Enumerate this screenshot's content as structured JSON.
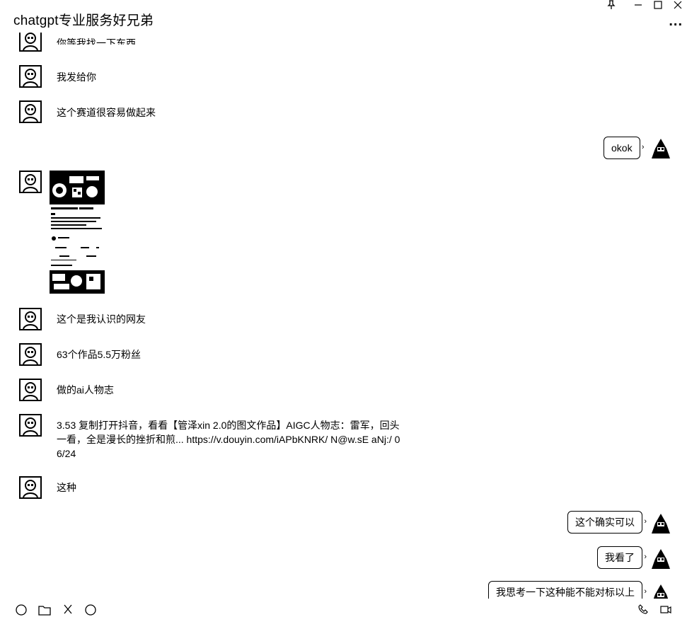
{
  "window": {
    "title": "chatgpt专业服务好兄弟",
    "pin_icon": "pin-icon",
    "minimize_icon": "minimize-icon",
    "maximize_icon": "maximize-icon",
    "close_icon": "close-icon",
    "more_label": "..."
  },
  "messages": [
    {
      "side": "left",
      "text": "你等我找一下东西"
    },
    {
      "side": "left",
      "text": "我发给你"
    },
    {
      "side": "left",
      "text": "这个赛道很容易做起来"
    },
    {
      "side": "right",
      "text": "okok"
    },
    {
      "side": "left",
      "type": "image",
      "text": ""
    },
    {
      "side": "left",
      "text": "这个是我认识的网友"
    },
    {
      "side": "left",
      "text": "63个作品5.5万粉丝"
    },
    {
      "side": "left",
      "text": "做的ai人物志"
    },
    {
      "side": "left",
      "text": "3.53 复制打开抖音，看看【管泽xin 2.0的图文作品】AIGC人物志：雷军，回头一看，全是漫长的挫折和煎... https://v.douyin.com/iAPbKNRK/ N@w.sE aNj:/ 06/24"
    },
    {
      "side": "left",
      "text": "这种"
    },
    {
      "side": "right",
      "text": "这个确实可以"
    },
    {
      "side": "right",
      "text": "我看了"
    },
    {
      "side": "right",
      "text": "我思考一下这种能不能对标以上"
    }
  ],
  "colors": {
    "background": "#ffffff",
    "text": "#000000",
    "bubble_border": "#000000"
  }
}
